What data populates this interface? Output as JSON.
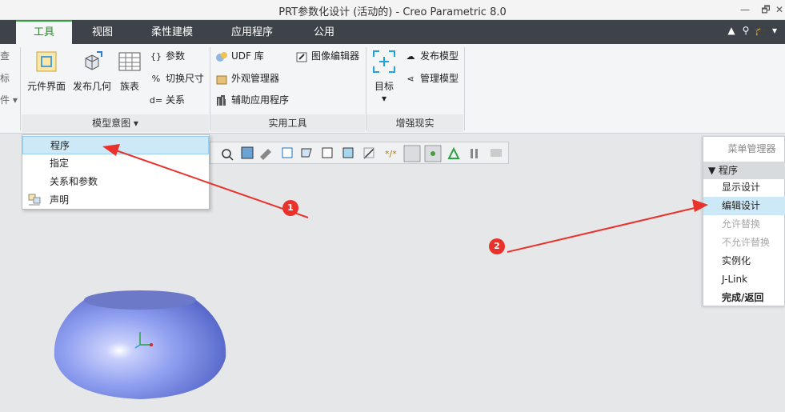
{
  "window": {
    "title": "PRT参数化设计 (活动的) - Creo Parametric 8.0",
    "controls": [
      "—",
      "🗗",
      "✕"
    ]
  },
  "tabs": [
    {
      "label": "工具",
      "active": true
    },
    {
      "label": "视图",
      "active": false
    },
    {
      "label": "柔性建模",
      "active": false
    },
    {
      "label": "应用程序",
      "active": false
    },
    {
      "label": "公用",
      "active": false
    }
  ],
  "tab_icons": [
    "caret-up-icon",
    "search-icon",
    "graduation-cap-icon",
    "chevron-down-icon"
  ],
  "ribbon": {
    "left_partial": [
      "查",
      "标",
      "件 ▾"
    ],
    "model_intent": {
      "label": "模型意图 ▾",
      "big_buttons": [
        "元件界面",
        "发布几何",
        "族表"
      ],
      "small_buttons": [
        "参数",
        "切换尺寸",
        "关系"
      ],
      "small_icons": [
        "{}",
        "%",
        "d="
      ]
    },
    "utilities": {
      "label": "实用工具",
      "buttons": [
        "UDF 库",
        "外观管理器",
        "辅助应用程序",
        "图像编辑器"
      ]
    },
    "ar": {
      "label": "增强现实",
      "target": "目标",
      "buttons": [
        "发布模型",
        "管理模型"
      ]
    }
  },
  "dropdown": {
    "items": [
      {
        "label": "程序",
        "highlighted": true
      },
      {
        "label": "指定",
        "highlighted": false
      },
      {
        "label": "关系和参数",
        "highlighted": false
      },
      {
        "label": "声明",
        "highlighted": false
      }
    ]
  },
  "menu_manager": {
    "title": "菜单管理器",
    "section": "▼ 程序",
    "items": [
      {
        "label": "显示设计",
        "state": "normal"
      },
      {
        "label": "编辑设计",
        "state": "highlighted"
      },
      {
        "label": "允许替换",
        "state": "disabled"
      },
      {
        "label": "不允许替换",
        "state": "disabled"
      },
      {
        "label": "实例化",
        "state": "normal"
      },
      {
        "label": "J-Link",
        "state": "normal"
      },
      {
        "label": "完成/返回",
        "state": "bold"
      }
    ]
  },
  "annotations": {
    "badge1": "1",
    "badge2": "2",
    "arrow_color": "#e8322b"
  },
  "colors": {
    "accent_green": "#2aa340",
    "tabbar": "#3d4348",
    "highlight": "#cde8f7",
    "model": "#8f9ff0"
  }
}
